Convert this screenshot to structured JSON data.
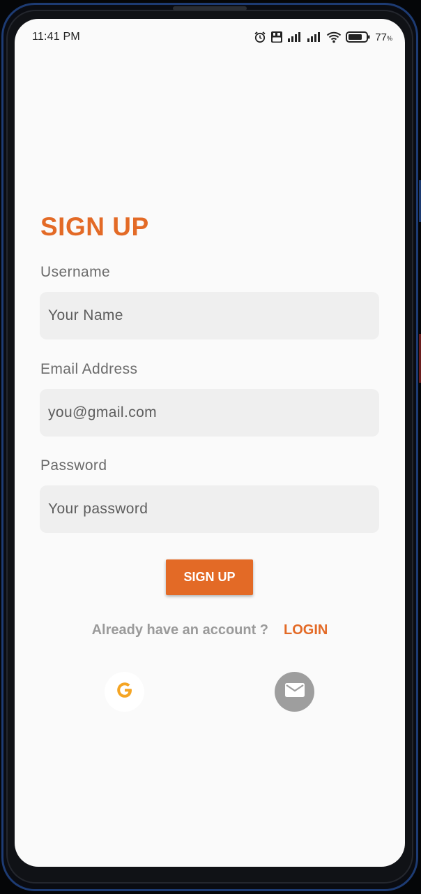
{
  "status_bar": {
    "time": "11:41 PM",
    "battery_percent": "77",
    "battery_unit": "%",
    "icons": [
      "alarm-icon",
      "volte-icon",
      "signal-icon",
      "signal-icon",
      "wifi-icon",
      "battery-icon"
    ]
  },
  "page": {
    "title": "SIGN UP"
  },
  "form": {
    "username": {
      "label": "Username",
      "placeholder": "Your Name",
      "value": ""
    },
    "email": {
      "label": "Email Address",
      "placeholder": "you@gmail.com",
      "value": ""
    },
    "password": {
      "label": "Password",
      "placeholder": "Your password",
      "value": ""
    },
    "submit_label": "SIGN UP"
  },
  "footer": {
    "account_text": "Already have an account ?",
    "login_label": "LOGIN"
  },
  "social": {
    "google_icon": "google-icon",
    "mail_icon": "mail-icon"
  },
  "colors": {
    "accent": "#e36a26",
    "background": "#fafafa",
    "input_bg": "#efefef",
    "label": "#6b6b6b",
    "muted": "#9a9a9a",
    "google_yellow": "#f5a524",
    "mail_bg": "#9e9e9e"
  }
}
